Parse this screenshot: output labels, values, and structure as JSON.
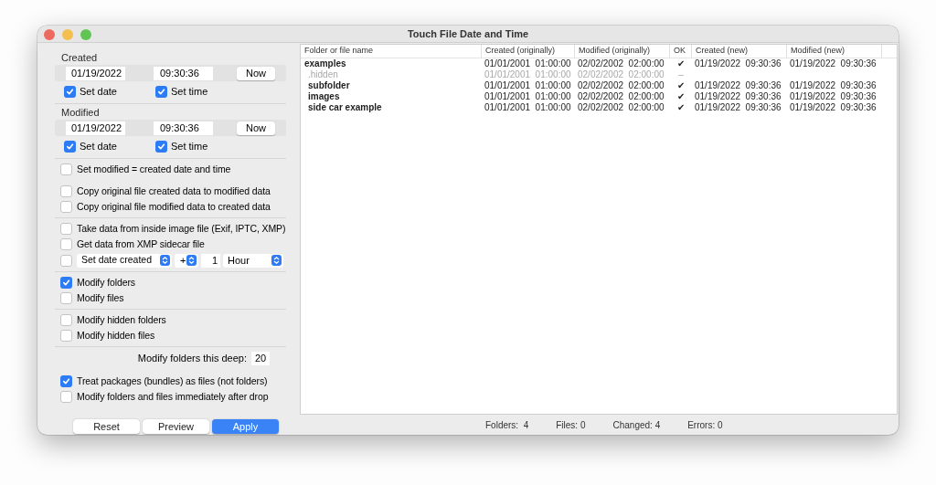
{
  "window": {
    "title": "Touch File Date and Time"
  },
  "created": {
    "label": "Created",
    "date": "01/19/2022",
    "time": "09:30:36",
    "now_button": "Now",
    "set_date": {
      "label": "Set date",
      "checked": true
    },
    "set_time": {
      "label": "Set time",
      "checked": true
    }
  },
  "modified": {
    "label": "Modified",
    "date": "01/19/2022",
    "time": "09:30:36",
    "now_button": "Now",
    "set_date": {
      "label": "Set date",
      "checked": true
    },
    "set_time": {
      "label": "Set time",
      "checked": true
    }
  },
  "option_groups": [
    {
      "blocks": [
        [
          {
            "kind": "checkbox",
            "label": "Set modified = created date and time",
            "checked": false
          }
        ],
        [
          {
            "kind": "checkbox",
            "label": "Copy original file created data to modified data",
            "checked": false
          },
          {
            "kind": "checkbox",
            "label": "Copy original file modified data to created data",
            "checked": false
          }
        ]
      ]
    },
    {
      "blocks": [
        [
          {
            "kind": "checkbox",
            "label": "Take data from inside image file (Exif, IPTC, XMP)",
            "checked": false
          },
          {
            "kind": "checkbox",
            "label": "Get data from XMP sidecar file",
            "checked": false
          },
          {
            "kind": "offset",
            "checked": false,
            "action": "Set date created",
            "sign": "+",
            "amount": "1",
            "unit": "Hour"
          }
        ]
      ]
    },
    {
      "blocks": [
        [
          {
            "kind": "checkbox",
            "label": "Modify folders",
            "checked": true
          },
          {
            "kind": "checkbox",
            "label": "Modify files",
            "checked": false
          }
        ]
      ]
    },
    {
      "blocks": [
        [
          {
            "kind": "checkbox",
            "label": "Modify hidden folders",
            "checked": false
          },
          {
            "kind": "checkbox",
            "label": "Modify hidden files",
            "checked": false
          }
        ]
      ]
    },
    {
      "blocks": [
        [
          {
            "kind": "depth",
            "label": "Modify folders this deep:",
            "value": "20"
          }
        ],
        [
          {
            "kind": "checkbox",
            "label": "Treat packages (bundles) as files (not folders)",
            "checked": true
          },
          {
            "kind": "checkbox",
            "label": "Modify folders and files immediately after drop",
            "checked": false
          }
        ]
      ]
    }
  ],
  "buttons": [
    {
      "label": "Reset",
      "primary": false
    },
    {
      "label": "Preview",
      "primary": false
    },
    {
      "label": "Apply",
      "primary": true
    }
  ],
  "table": {
    "columns": [
      "Folder or file name",
      "Created (originally)",
      "Modified (originally)",
      "OK",
      "Created (new)",
      "Modified (new)"
    ],
    "rows": [
      {
        "name": "examples",
        "disabled": false,
        "created": [
          "01/01/2001",
          "01:00:00"
        ],
        "modified": [
          "02/02/2002",
          "02:00:00"
        ],
        "ok": "✔",
        "created_new": [
          "01/19/2022",
          "09:30:36"
        ],
        "modified_new": [
          "01/19/2022",
          "09:30:36"
        ],
        "children": [
          {
            "name": ".hidden",
            "disabled": true,
            "created": [
              "01/01/2001",
              "01:00:00"
            ],
            "modified": [
              "02/02/2002",
              "02:00:00"
            ],
            "ok": "–"
          },
          {
            "name": "subfolder",
            "disabled": false,
            "created": [
              "01/01/2001",
              "01:00:00"
            ],
            "modified": [
              "02/02/2002",
              "02:00:00"
            ],
            "ok": "✔",
            "created_new": [
              "01/19/2022",
              "09:30:36"
            ],
            "modified_new": [
              "01/19/2022",
              "09:30:36"
            ]
          },
          {
            "name": "images",
            "disabled": false,
            "created": [
              "01/01/2001",
              "01:00:00"
            ],
            "modified": [
              "02/02/2002",
              "02:00:00"
            ],
            "ok": "✔",
            "created_new": [
              "01/19/2022",
              "09:30:36"
            ],
            "modified_new": [
              "01/19/2022",
              "09:30:36"
            ]
          },
          {
            "name": "side car example",
            "disabled": false,
            "created": [
              "01/01/2001",
              "01:00:00"
            ],
            "modified": [
              "02/02/2002",
              "02:00:00"
            ],
            "ok": "✔",
            "created_new": [
              "01/19/2022",
              "09:30:36"
            ],
            "modified_new": [
              "01/19/2022",
              "09:30:36"
            ]
          }
        ]
      }
    ]
  },
  "status_bar": [
    "Folders:  4",
    "Files: 0",
    "Changed: 4",
    "Errors: 0"
  ]
}
